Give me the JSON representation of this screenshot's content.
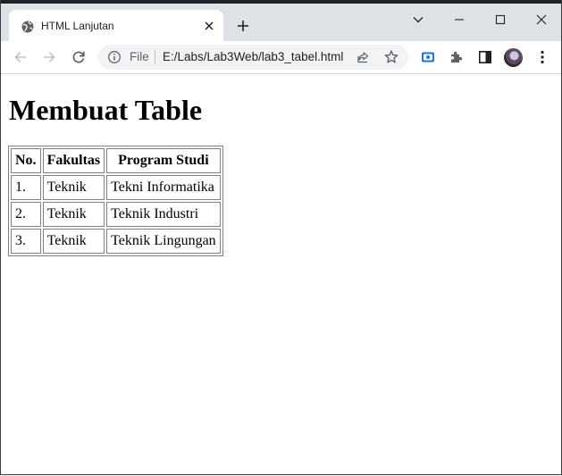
{
  "tab": {
    "title": "HTML Lanjutan"
  },
  "omnibox": {
    "scheme_label": "File",
    "url": "E:/Labs/Lab3Web/lab3_tabel.html"
  },
  "page": {
    "heading": "Membuat Table",
    "table": {
      "headers": [
        "No.",
        "Fakultas",
        "Program Studi"
      ],
      "rows": [
        [
          "1.",
          "Teknik",
          "Tekni Informatika"
        ],
        [
          "2.",
          "Teknik",
          "Teknik Industri"
        ],
        [
          "3.",
          "Teknik",
          "Teknik Lingungan"
        ]
      ]
    }
  },
  "colors": {
    "tabstrip_bg": "#dee1e6",
    "omnibox_bg": "#f1f3f4",
    "accent_blue": "#1a73e8",
    "icon_gray": "#5f6368",
    "table_border": "#808080"
  },
  "icons": {
    "favicon": "globe-icon",
    "tab_close": "close-icon",
    "new_tab": "plus-icon",
    "tab_search": "chevron-down-icon",
    "minimize": "minimize-icon",
    "maximize": "maximize-icon",
    "close_window": "close-icon",
    "back": "arrow-left-icon",
    "forward": "arrow-right-icon",
    "reload": "reload-icon",
    "site_info": "info-icon",
    "share": "share-icon",
    "bookmark": "star-icon",
    "cast": "cast-icon",
    "extensions": "puzzle-icon",
    "side_panel": "side-panel-icon",
    "menu": "kebab-menu-icon"
  }
}
